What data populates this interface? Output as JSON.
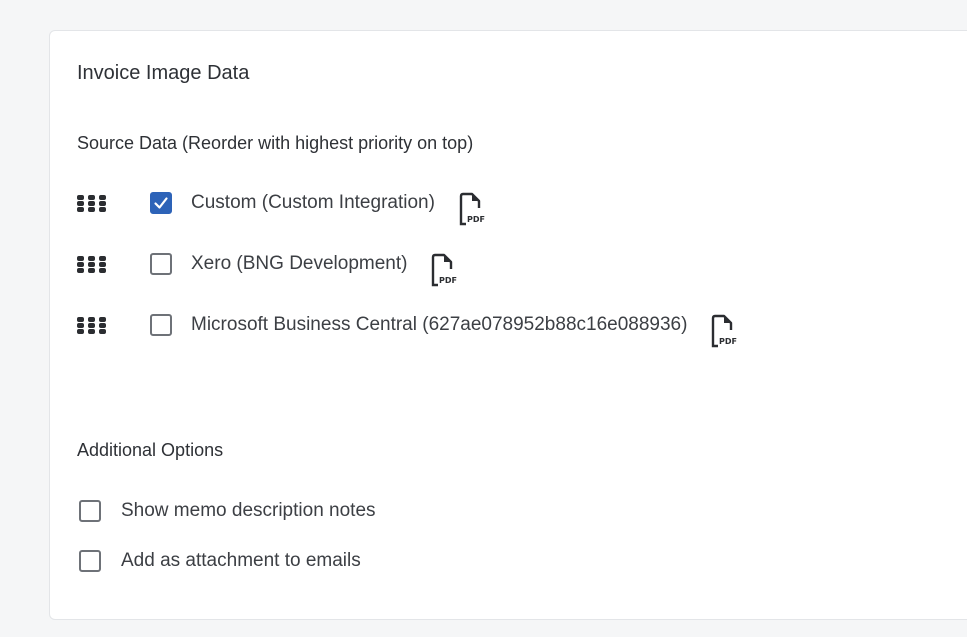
{
  "panel": {
    "title": "Invoice Image Data"
  },
  "source_data": {
    "heading": "Source Data (Reorder with highest priority on top)",
    "items": [
      {
        "label": "Custom (Custom Integration)",
        "checked": true,
        "icon": "pdf-icon",
        "handle_icon": "drag-handle-icon"
      },
      {
        "label": "Xero (BNG Development)",
        "checked": false,
        "icon": "pdf-icon",
        "handle_icon": "drag-handle-icon"
      },
      {
        "label": "Microsoft Business Central (627ae078952b88c16e088936)",
        "checked": false,
        "icon": "pdf-icon",
        "handle_icon": "drag-handle-icon"
      }
    ]
  },
  "additional_options": {
    "heading": "Additional Options",
    "items": [
      {
        "label": "Show memo description notes",
        "checked": false
      },
      {
        "label": "Add as attachment to emails",
        "checked": false
      }
    ]
  },
  "colors": {
    "accent": "#2d63b8",
    "background": "#f5f6f7",
    "panel": "#ffffff",
    "text": "#3c3f44"
  }
}
